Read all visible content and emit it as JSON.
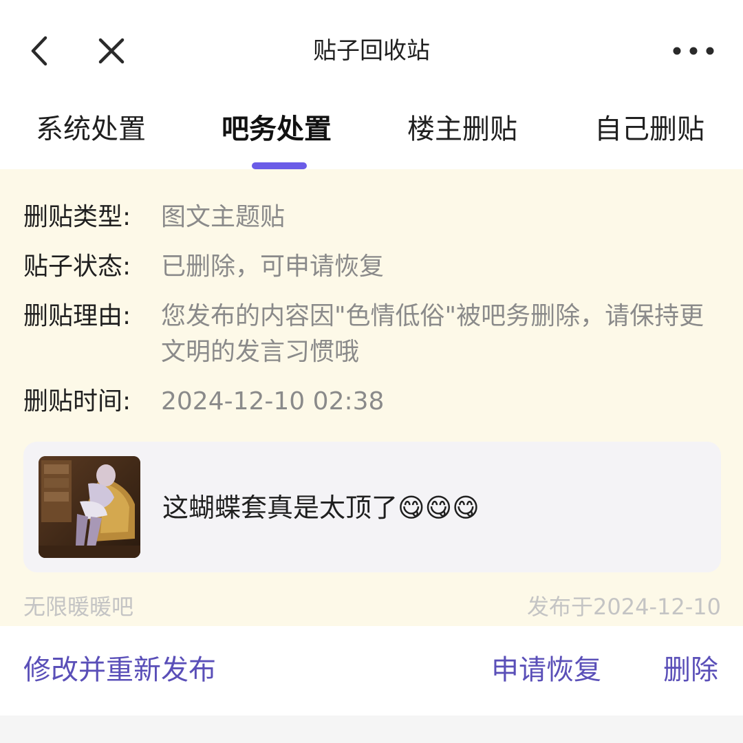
{
  "header": {
    "title": "贴子回收站",
    "back_icon": "chevron-left-icon",
    "close_icon": "close-icon",
    "more_icon": "more-horizontal-icon"
  },
  "tabs": [
    {
      "label": "系统处置",
      "active": false
    },
    {
      "label": "吧务处置",
      "active": true
    },
    {
      "label": "楼主删贴",
      "active": false
    },
    {
      "label": "自己删贴",
      "active": false
    }
  ],
  "info": {
    "type_label": "删贴类型:",
    "type_value": "图文主题贴",
    "status_label": "贴子状态:",
    "status_value": "已删除，可申请恢复",
    "reason_label": "删贴理由:",
    "reason_value": "您发布的内容因\"色情低俗\"被吧务删除，请保持更文明的发言习惯哦",
    "time_label": "删贴时间:",
    "time_value": "2024-12-10 02:38"
  },
  "post": {
    "text": "这蝴蝶套真是太顶了😋😋😋",
    "forum": "无限暖暖吧",
    "published": "发布于2024-12-10"
  },
  "actions": {
    "edit_label": "修改并重新发布",
    "restore_label": "申请恢复",
    "delete_label": "删除"
  },
  "colors": {
    "accent": "#6b5ce7",
    "action_text": "#5a4fb8",
    "panel_bg": "#fdf9e8"
  }
}
